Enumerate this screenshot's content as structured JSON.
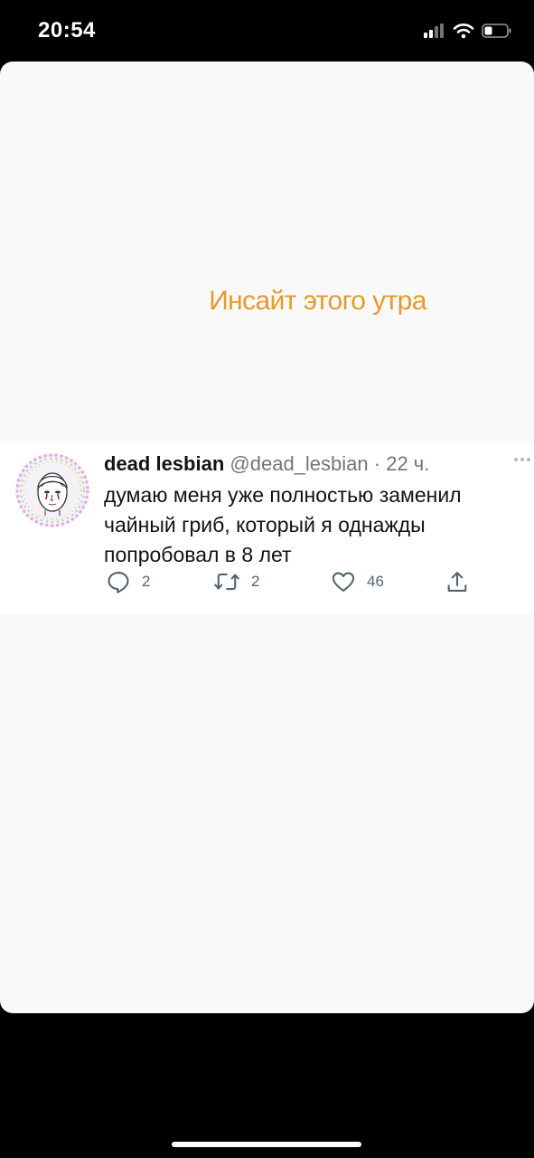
{
  "status_bar": {
    "time": "20:54",
    "icons": [
      "signal-icon",
      "wifi-icon",
      "battery-icon"
    ]
  },
  "caption": {
    "text": "Инсайт этого утра",
    "color": "#e79a2c"
  },
  "tweet": {
    "display_name": "dead lesbian",
    "handle": "@dead_lesbian",
    "separator": "·",
    "time": "22 ч.",
    "text": "думаю меня уже полностью заменил чайный гриб, который я однажды попробовал в 8 лет",
    "actions": {
      "reply": {
        "icon": "reply-icon",
        "count": "2"
      },
      "retweet": {
        "icon": "retweet-icon",
        "count": "2"
      },
      "like": {
        "icon": "heart-icon",
        "count": "46"
      },
      "share": {
        "icon": "share-icon"
      }
    }
  },
  "colors": {
    "sheet_background": "#f9f9f9",
    "tweet_background": "#ffffff",
    "secondary_text": "#6e767d"
  }
}
